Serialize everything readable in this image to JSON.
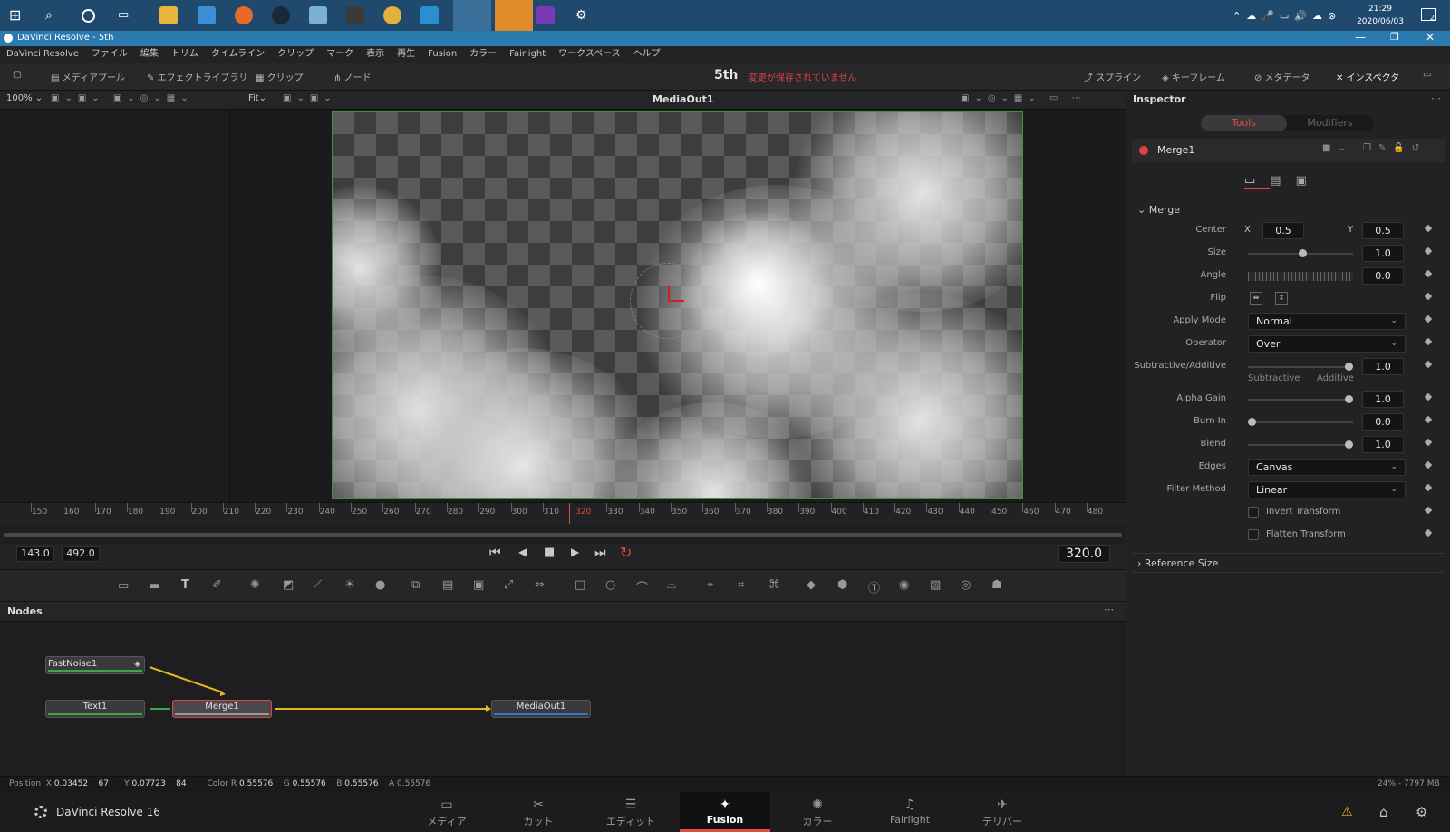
{
  "taskbar": {
    "time": "21:29",
    "date": "2020/06/03",
    "notif_count": "2"
  },
  "window": {
    "title": "DaVinci Resolve - 5th"
  },
  "menu": [
    "DaVinci Resolve",
    "ファイル",
    "編集",
    "トリム",
    "タイムライン",
    "クリップ",
    "マーク",
    "表示",
    "再生",
    "Fusion",
    "カラー",
    "Fairlight",
    "ワークスペース",
    "ヘルプ"
  ],
  "toolbar": {
    "media_pool": "メディアプール",
    "effects_library": "エフェクトライブラリ",
    "clips": "クリップ",
    "nodes": "ノード",
    "project_name": "5th",
    "unsaved": "変更が保存されていません",
    "spline": "スプライン",
    "keyframes": "キーフレーム",
    "metadata": "メタデータ",
    "inspector": "インスペクタ"
  },
  "viewer": {
    "zoom": "100%",
    "fit": "Fit",
    "title": "MediaOut1"
  },
  "ruler": {
    "ticks": [
      "150",
      "160",
      "170",
      "180",
      "190",
      "200",
      "210",
      "220",
      "230",
      "240",
      "250",
      "260",
      "270",
      "280",
      "290",
      "300",
      "310",
      "320",
      "330",
      "340",
      "350",
      "360",
      "370",
      "380",
      "390",
      "400",
      "410",
      "420",
      "430",
      "440",
      "450",
      "460",
      "470",
      "480"
    ],
    "playhead": "320"
  },
  "transport": {
    "range_start": "143.0",
    "range_end": "492.0",
    "current": "320.0"
  },
  "nodes_panel": {
    "title": "Nodes",
    "fastnoise": "FastNoise1",
    "text": "Text1",
    "merge": "Merge1",
    "mediaout": "MediaOut1"
  },
  "inspector": {
    "title": "Inspector",
    "tab_tools": "Tools",
    "tab_modifiers": "Modifiers",
    "node_name": "Merge1",
    "section": "Merge",
    "center_label": "Center",
    "center_x_label": "X",
    "center_x": "0.5",
    "center_y_label": "Y",
    "center_y": "0.5",
    "size_label": "Size",
    "size": "1.0",
    "angle_label": "Angle",
    "angle": "0.0",
    "flip_label": "Flip",
    "apply_mode_label": "Apply Mode",
    "apply_mode": "Normal",
    "operator_label": "Operator",
    "operator": "Over",
    "subadd_label": "Subtractive/Additive",
    "subadd": "1.0",
    "subtractive": "Subtractive",
    "additive": "Additive",
    "alpha_gain_label": "Alpha Gain",
    "alpha_gain": "1.0",
    "burn_in_label": "Burn In",
    "burn_in": "0.0",
    "blend_label": "Blend",
    "blend": "1.0",
    "edges_label": "Edges",
    "edges": "Canvas",
    "filter_label": "Filter Method",
    "filter": "Linear",
    "invert": "Invert Transform",
    "flatten": "Flatten Transform",
    "ref_size": "Reference Size"
  },
  "status": {
    "position_label": "Position",
    "x_label": "X",
    "x": "0.03452",
    "px": "67",
    "y_label": "Y",
    "y": "0.07723",
    "py": "84",
    "color_label": "Color",
    "r_label": "R",
    "r": "0.55576",
    "g_label": "G",
    "g": "0.55576",
    "b_label": "B",
    "b": "0.55576",
    "a_label": "A",
    "a": "0.55576",
    "memory": "24% - 7797 MB"
  },
  "pages": {
    "app": "DaVinci Resolve 16",
    "media": "メディア",
    "cut": "カット",
    "edit": "エディット",
    "fusion": "Fusion",
    "color": "カラー",
    "fairlight": "Fairlight",
    "deliver": "デリバー"
  },
  "colors": {
    "accent": "#e04b3b",
    "selection": "#e24545",
    "connector": "#e6b820"
  }
}
